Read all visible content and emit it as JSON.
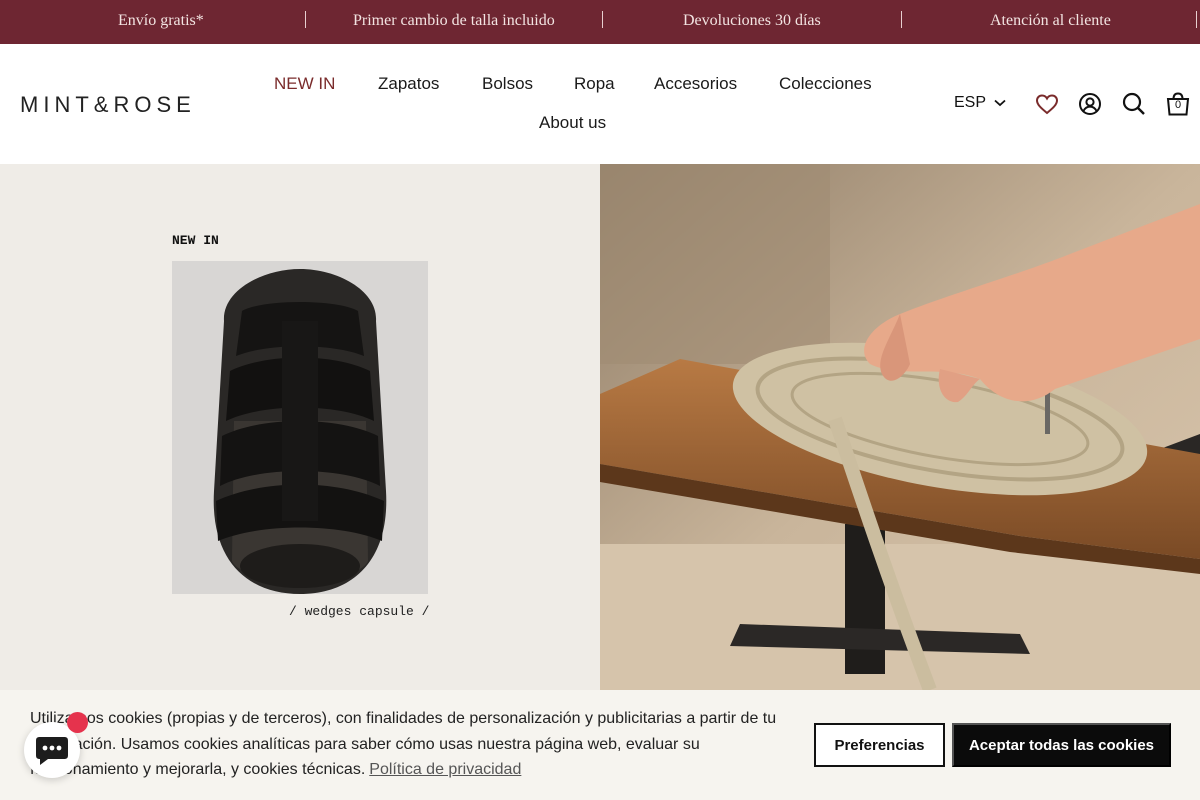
{
  "announcement": {
    "items": [
      "Envío gratis*",
      "Primer cambio de talla incluido",
      "Devoluciones 30 días",
      "Atención al cliente"
    ]
  },
  "header": {
    "logo": "MINT&ROSE",
    "nav": [
      "NEW IN",
      "Zapatos",
      "Bolsos",
      "Ropa",
      "Accesorios",
      "Colecciones",
      "About us"
    ],
    "language": "ESP",
    "cart_count": "0",
    "icons": [
      "chevron-down-icon",
      "heart-icon",
      "account-icon",
      "search-icon",
      "bag-icon"
    ]
  },
  "hero": {
    "label": "NEW IN",
    "caption": "/ wedges capsule /"
  },
  "cookie": {
    "text": "Utilizamos cookies (propias y de terceros), con finalidades de personalización y publicitarias a partir de tu navegación. Usamos cookies analíticas para saber cómo usas nuestra página web, evaluar su funcionamiento y mejorarla, y cookies técnicas.",
    "link": "Política de privacidad",
    "preferences": "Preferencias",
    "accept": "Aceptar todas las cookies"
  },
  "colors": {
    "announcement_bg": "#6e2632",
    "active_nav": "#7a2b2b",
    "hero_left_bg": "#efece7",
    "cookie_bg": "#f6f4ef",
    "accept_button": "#0b0b0b",
    "chat_badge": "#e5334d"
  }
}
